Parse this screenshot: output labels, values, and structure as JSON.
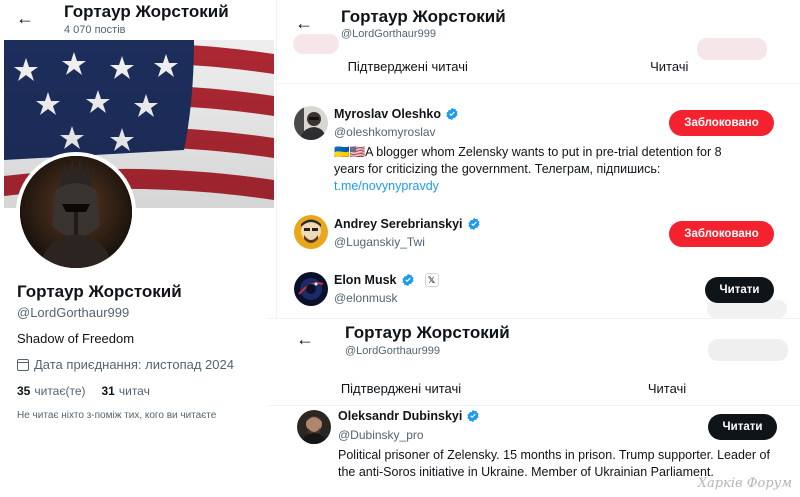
{
  "profile": {
    "title": "Гортаур Жорстокий",
    "posts_count": "4 070 постів",
    "name": "Гортаур Жорстокий",
    "handle": "@LordGorthaur999",
    "bio": "Shadow of Freedom",
    "joined": "Дата приєднання: листопад 2024",
    "following_count": "35",
    "following_label": "читає(те)",
    "followers_count": "31",
    "followers_label": "читач",
    "note": "Не читає ніхто з-поміж тих, кого ви читаєте"
  },
  "panel_b": {
    "title": "Гортаур Жорстокий",
    "handle": "@LordGorthaur999",
    "tabs": [
      "Підтверджені читачі",
      "Читачі"
    ],
    "users": [
      {
        "name": "Myroslav Oleshko",
        "handle": "@oleshkomyroslav",
        "bio": "🇺🇦🇺🇸A blogger whom Zelensky wants to put in pre-trial detention for 8 years for criticizing the government. Телеграм, підпишись:",
        "link": "t.me/novynypravdy",
        "button": "Заблоковано"
      },
      {
        "name": "Andrey Serebrianskyi",
        "handle": "@Luganskiy_Twi",
        "button": "Заблоковано"
      },
      {
        "name": "Elon Musk",
        "handle": "@elonmusk",
        "badge": "𝕏",
        "button": "Читати"
      }
    ]
  },
  "panel_c": {
    "title": "Гортаур Жорстокий",
    "handle": "@LordGorthaur999",
    "tabs": [
      "Підтверджені читачі",
      "Читачі"
    ],
    "users": [
      {
        "name": "Oleksandr Dubinskyi",
        "handle": "@Dubinsky_pro",
        "bio": "Political prisoner of Zelensky. 15 months in prison. Trump supporter. Leader of the anti-Soros initiative in Ukraine. Member of Ukrainian Parliament.",
        "button": "Читати"
      }
    ]
  },
  "icons": {
    "back": "arrow-left-icon",
    "verified": "verified-badge-icon",
    "calendar": "calendar-icon"
  },
  "colors": {
    "verified": "#1d9bf0",
    "blocked_button": "#f4212e",
    "follow_button": "#0f1419",
    "link": "#1d9bf0",
    "muted_text": "#536471"
  },
  "watermark": "Харків Форум"
}
